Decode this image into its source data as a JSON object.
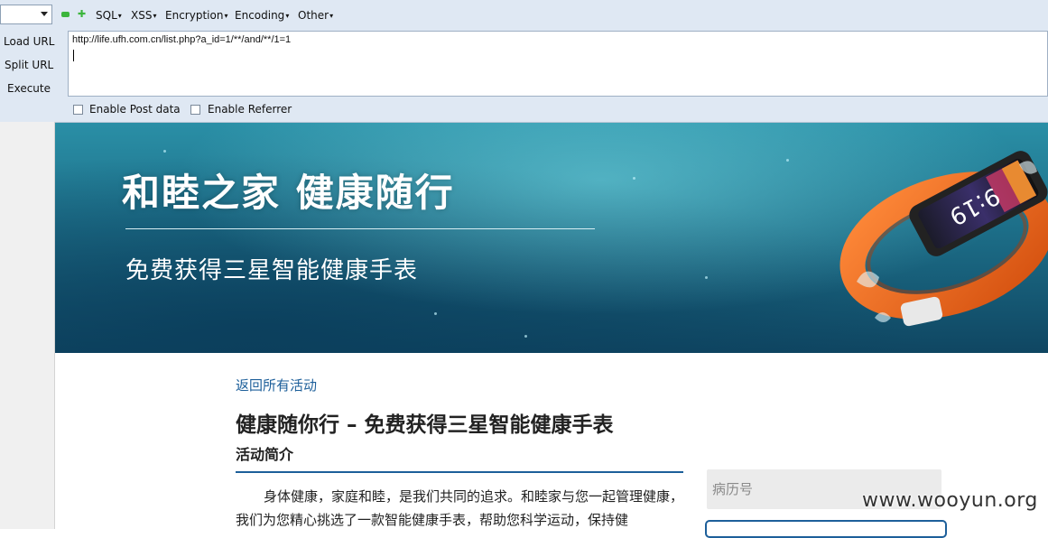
{
  "hackbar": {
    "menu": [
      "SQL",
      "XSS",
      "Encryption",
      "Encoding",
      "Other"
    ],
    "side_buttons": [
      "Load URL",
      "Split URL",
      "Execute"
    ],
    "url_value": "http://life.ufh.com.cn/list.php?a_id=1/**/and/**/1=1",
    "enable_post_label": "Enable Post data",
    "enable_referrer_label": "Enable Referrer"
  },
  "banner": {
    "title": "和睦之家   健康随行",
    "subtitle": "免费获得三星智能健康手表",
    "watch_time": "9:19"
  },
  "content": {
    "back_link": "返回所有活动",
    "title": "健康随你行 – 免费获得三星智能健康手表",
    "section_title": "活动简介",
    "paragraph": "身体健康，家庭和睦，是我们共同的追求。和睦家与您一起管理健康，我们为您精心挑选了一款智能健康手表，帮助您科学运动，保持健"
  },
  "sidebar_form": {
    "record_placeholder": "病历号"
  },
  "watermark": "www.wooyun.org",
  "colors": {
    "toolbar_bg": "#dfe8f3",
    "link_blue": "#1d5f9a",
    "banner_teal": "#1d6f89",
    "watch_orange": "#f06a1c"
  }
}
